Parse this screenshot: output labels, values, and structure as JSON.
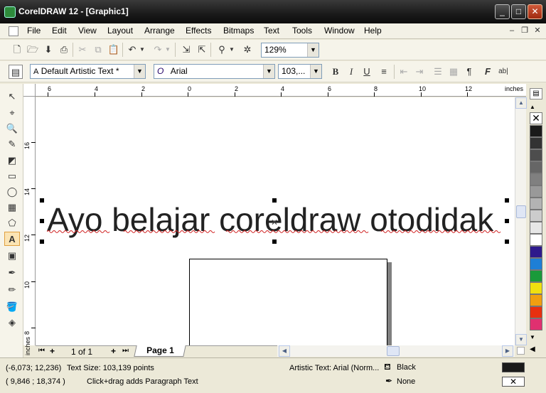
{
  "window": {
    "title": "CorelDRAW 12 - [Graphic1]",
    "controls": {
      "minimize": "_",
      "maximize": "□",
      "close": "✕"
    }
  },
  "menu": [
    "File",
    "Edit",
    "View",
    "Layout",
    "Arrange",
    "Effects",
    "Bitmaps",
    "Text",
    "Tools",
    "Window",
    "Help"
  ],
  "standard_toolbar": {
    "zoom_value": "129%"
  },
  "property_bar": {
    "style": "Default Artistic Text *",
    "font_name": "Arial",
    "font_size": "103,...",
    "bold": "B",
    "italic": "I",
    "underline": "U"
  },
  "ruler": {
    "unit": "inches",
    "h_labels": [
      "6",
      "4",
      "2",
      "0",
      "2",
      "4",
      "6",
      "8",
      "10",
      "12"
    ],
    "v_labels": [
      "16",
      "14",
      "12",
      "10",
      "8"
    ],
    "v_unit": "inches"
  },
  "canvas": {
    "artistic_text": "Ayo belajar coreldraw otodidak"
  },
  "pages": {
    "counter": "1 of 1",
    "tab": "Page 1"
  },
  "palette": {
    "colors": [
      "#1a1a1a",
      "#333333",
      "#4d4d4d",
      "#666666",
      "#808080",
      "#999999",
      "#b3b3b3",
      "#cccccc",
      "#e6e6e6",
      "#ffffff",
      "#2e1a8c",
      "#1e7fd6",
      "#1a9a3a",
      "#f0e010",
      "#f0a010",
      "#e83010",
      "#e03070"
    ]
  },
  "status": {
    "coords1": "(-6,073; 12,236)",
    "text_size": "Text Size: 103,139 points",
    "coords2": "( 9,846 ; 18,374 )",
    "hint": "Click+drag adds Paragraph Text",
    "object_info": "Artistic Text: Arial (Norm...",
    "fill_label": "Black",
    "outline_label": "None",
    "fill_color": "#1a1a1a"
  }
}
